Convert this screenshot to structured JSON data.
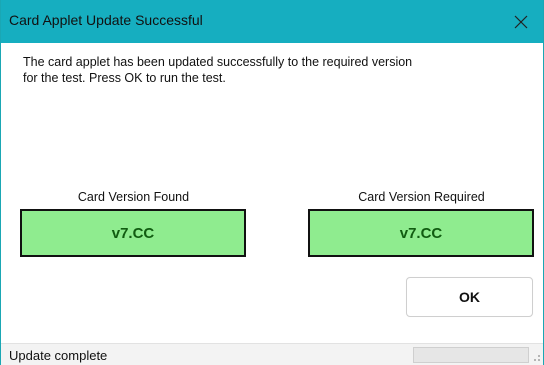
{
  "window": {
    "title": "Card Applet Update Successful",
    "accent_color": "#16aec0"
  },
  "message": "The card applet has been updated successfully to the required version for the test. Press OK to run the test.",
  "versions": {
    "found": {
      "label": "Card Version Found",
      "value": "v7.CC"
    },
    "required": {
      "label": "Card Version Required",
      "value": "v7.CC"
    },
    "match_color": "#8fec8f"
  },
  "buttons": {
    "ok_label": "OK"
  },
  "icons": {
    "close": "close-icon",
    "grip": "resize-grip-icon"
  },
  "status_bar": {
    "text": "Update complete"
  }
}
